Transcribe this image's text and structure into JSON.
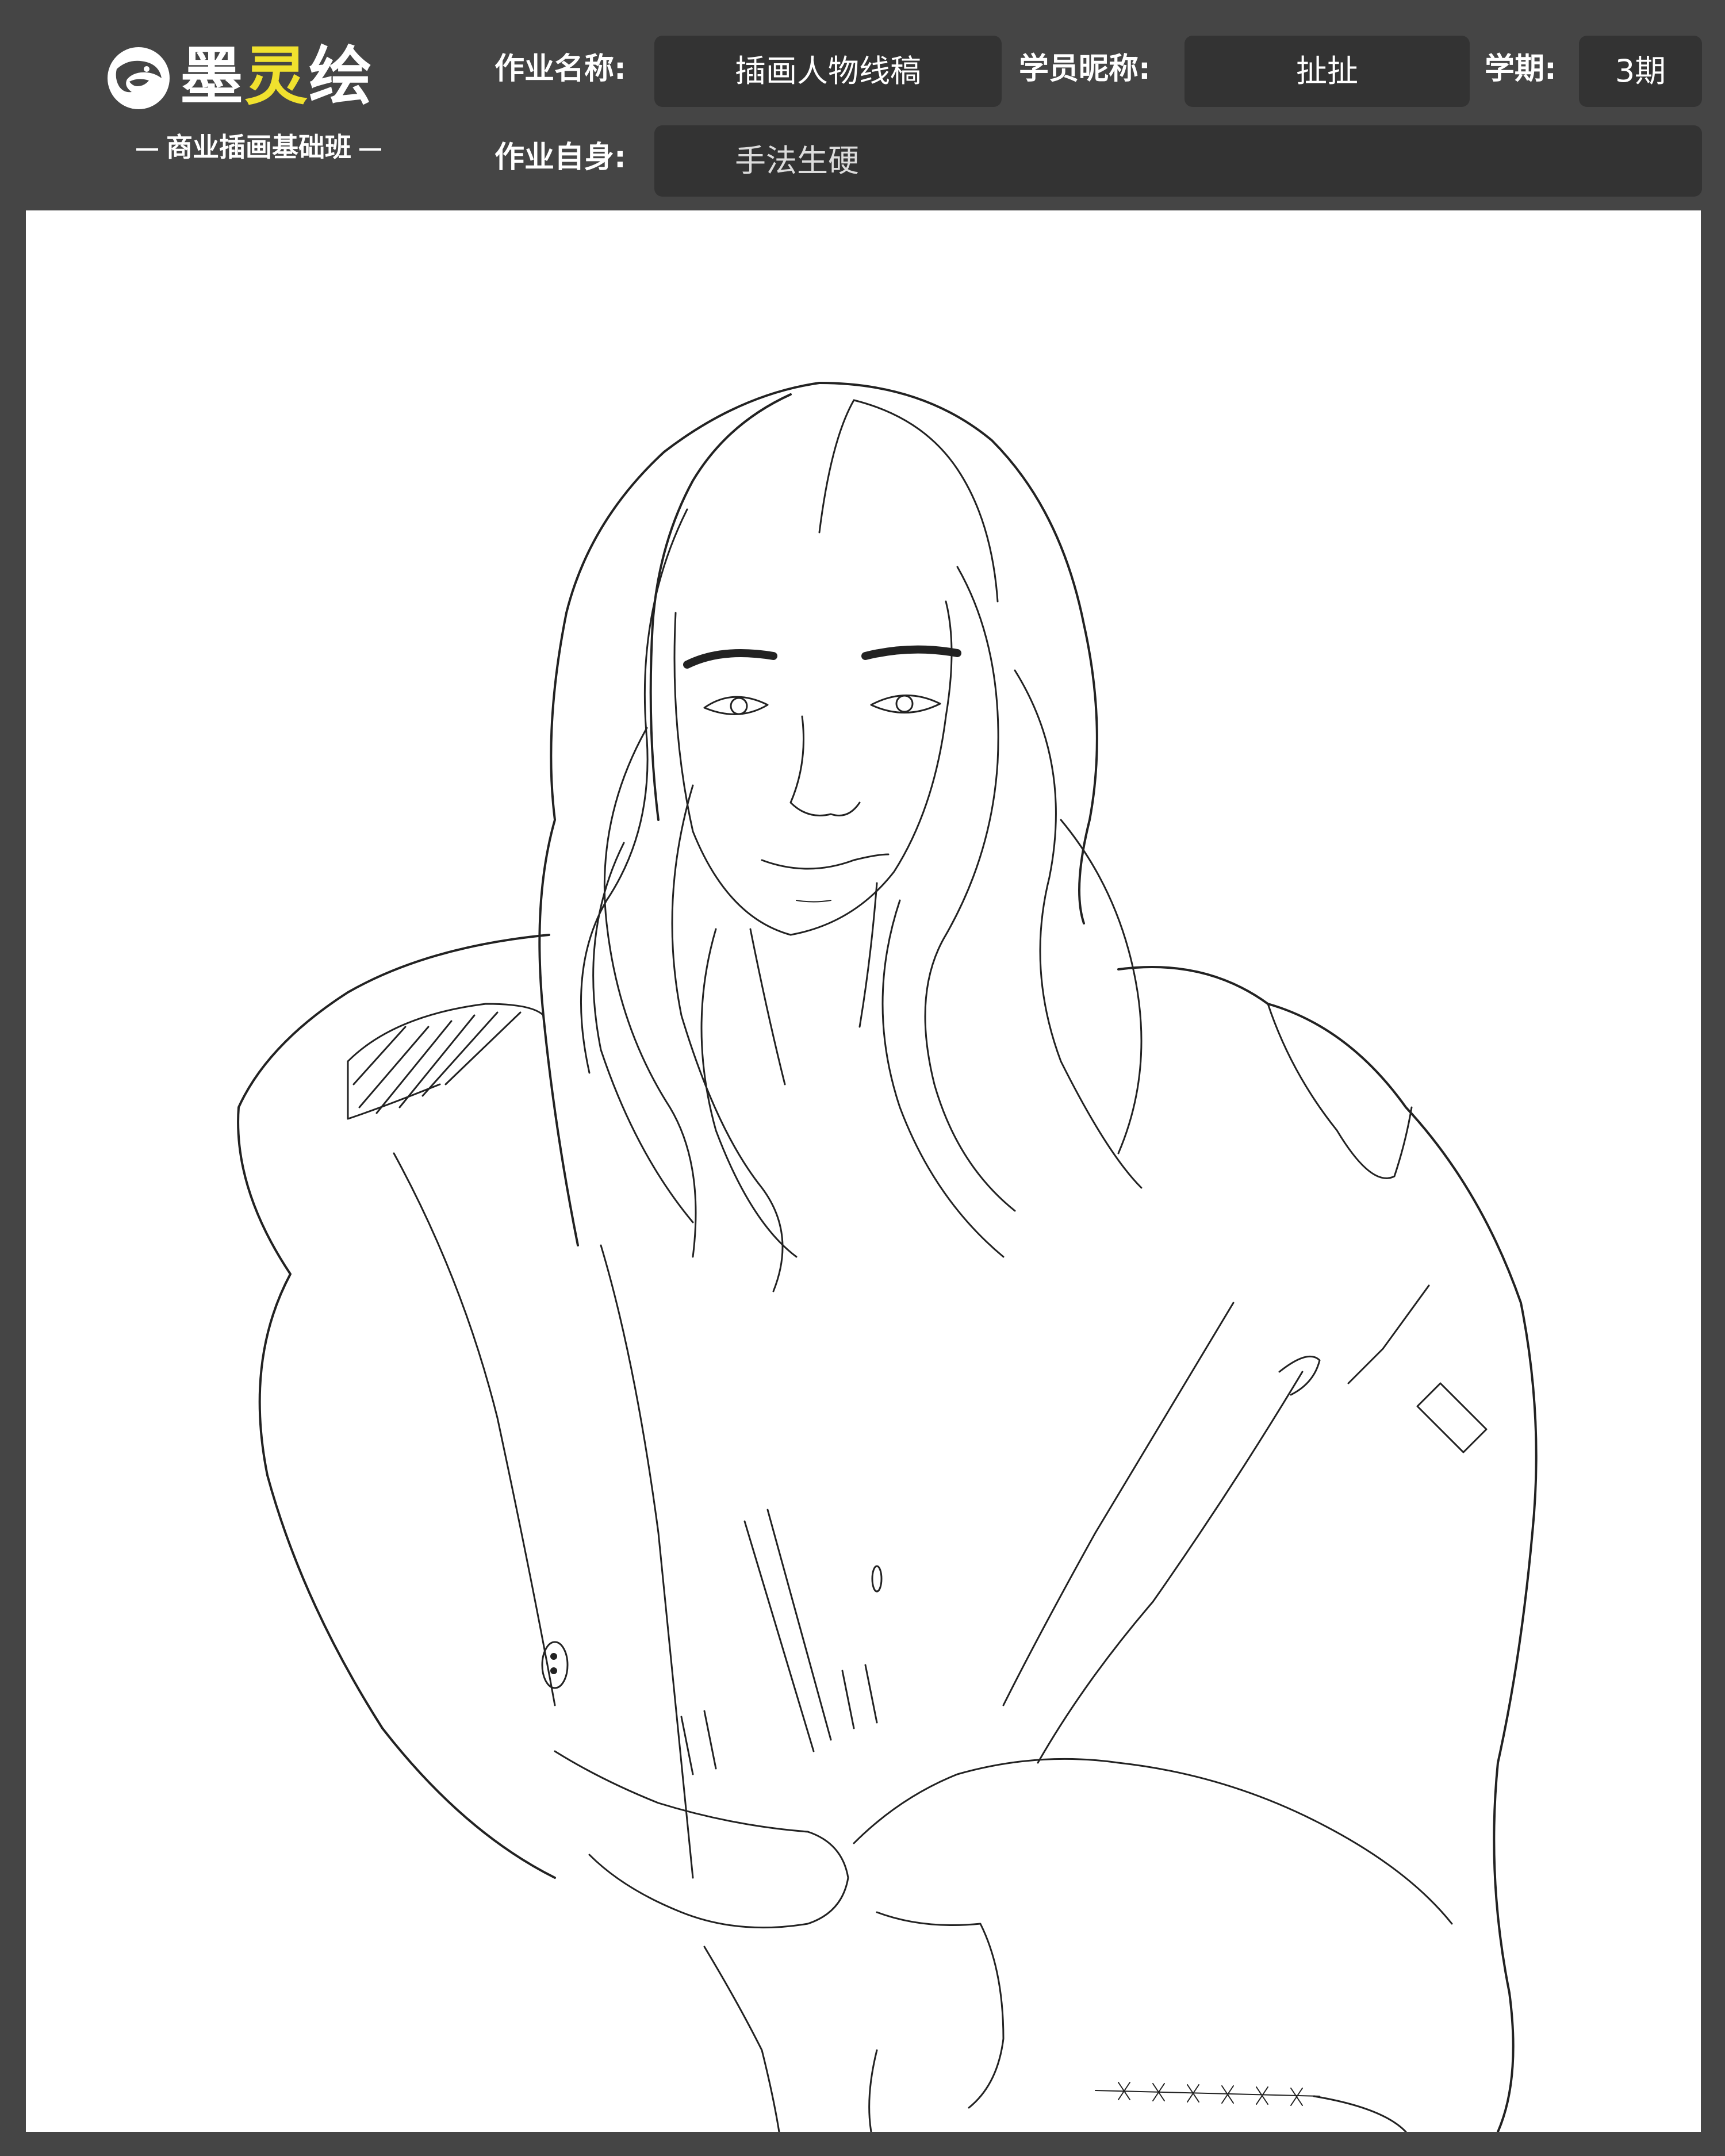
{
  "logo": {
    "name_part1": "墨",
    "name_part2": "灵",
    "name_part3": "绘",
    "subtitle": "商业插画基础班",
    "icon": "fox-head-icon",
    "accent_color": "#f0e12e"
  },
  "form": {
    "assignment_name_label": "作业名称:",
    "assignment_name_value": "插画人物线稿",
    "student_nickname_label": "学员昵称:",
    "student_nickname_value": "扯扯",
    "term_label": "学期:",
    "term_value": "3期",
    "self_review_label": "作业自身:",
    "self_review_value": "手法生硬"
  },
  "artwork": {
    "icon": "line-drawing-portrait-icon"
  }
}
